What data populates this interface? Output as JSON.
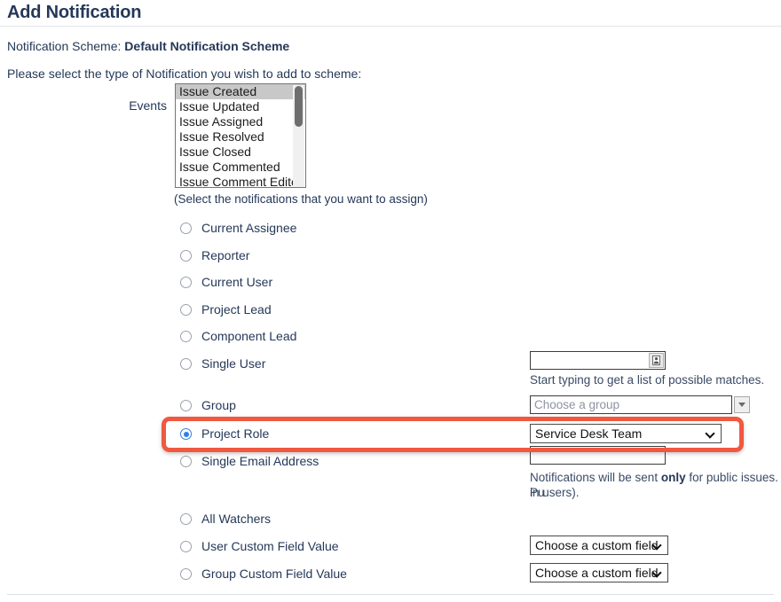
{
  "header": {
    "title": "Add Notification"
  },
  "scheme": {
    "label": "Notification Scheme:",
    "value": "Default Notification Scheme"
  },
  "instruction": "Please select the type of Notification you wish to add to scheme:",
  "events": {
    "label": "Events",
    "hint": "(Select the notifications that you want to assign)",
    "options": [
      "Issue Created",
      "Issue Updated",
      "Issue Assigned",
      "Issue Resolved",
      "Issue Closed",
      "Issue Commented",
      "Issue Comment Edited"
    ],
    "selected": "Issue Created"
  },
  "options": [
    {
      "id": "current-assignee",
      "label": "Current Assignee",
      "checked": false
    },
    {
      "id": "reporter",
      "label": "Reporter",
      "checked": false
    },
    {
      "id": "current-user",
      "label": "Current User",
      "checked": false
    },
    {
      "id": "project-lead",
      "label": "Project Lead",
      "checked": false
    },
    {
      "id": "component-lead",
      "label": "Component Lead",
      "checked": false
    },
    {
      "id": "single-user",
      "label": "Single User",
      "checked": false
    },
    {
      "id": "group",
      "label": "Group",
      "checked": false
    },
    {
      "id": "project-role",
      "label": "Project Role",
      "checked": true
    },
    {
      "id": "single-email-address",
      "label": "Single Email Address",
      "checked": false
    },
    {
      "id": "all-watchers",
      "label": "All Watchers",
      "checked": false
    },
    {
      "id": "user-custom-field-value",
      "label": "User Custom Field Value",
      "checked": false
    },
    {
      "id": "group-custom-field-value",
      "label": "Group Custom Field Value",
      "checked": false
    }
  ],
  "controls": {
    "single_user": {
      "value": "",
      "placeholder": "",
      "picker_icon": "user-picker-icon",
      "helper": "Start typing to get a list of possible matches."
    },
    "group": {
      "placeholder": "Choose a group",
      "arrow_icon": "chevron-down-icon"
    },
    "project_role": {
      "value": "Service Desk Team",
      "arrow_icon": "chevron-down-icon"
    },
    "single_email": {
      "value": "",
      "helper_part1": "Notifications will be sent ",
      "helper_bold": "only",
      "helper_part2": " for public issues. Pu",
      "helper_line2": "in users)."
    },
    "user_custom_field": {
      "value": "Choose a custom field",
      "arrow_icon": "chevron-down-icon"
    },
    "group_custom_field": {
      "value": "Choose a custom field",
      "arrow_icon": "chevron-down-icon"
    }
  },
  "colors": {
    "annotation": "#f0583f",
    "text": "#253858",
    "radio_checked": "#2f7ef0"
  }
}
